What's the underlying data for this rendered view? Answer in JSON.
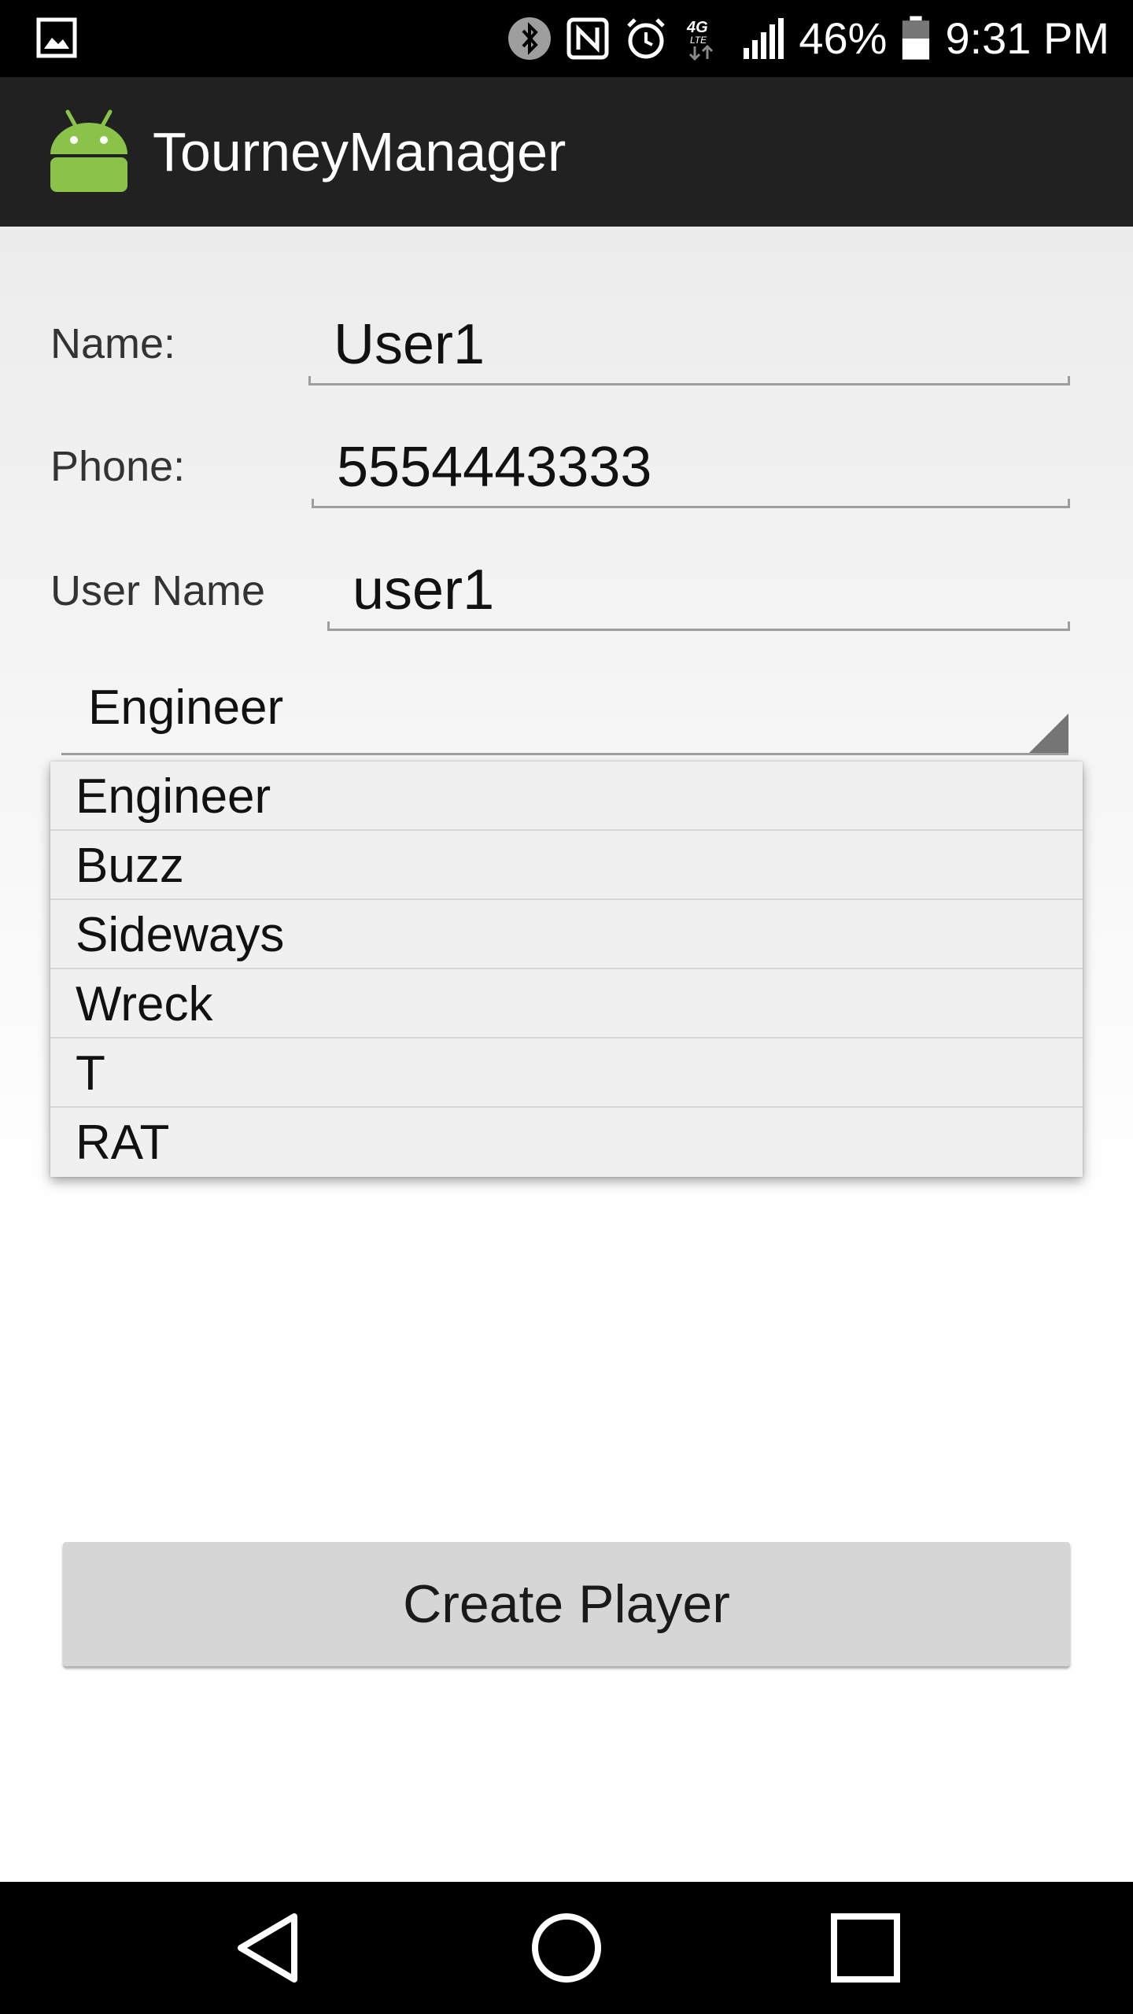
{
  "status_bar": {
    "battery_percent": "46%",
    "time": "9:31 PM",
    "network": "4G LTE",
    "icons": [
      "gallery-icon",
      "bluetooth-icon",
      "nfc-icon",
      "alarm-icon",
      "network-4g-lte-icon",
      "signal-icon",
      "battery-icon"
    ]
  },
  "app_bar": {
    "title": "TourneyManager",
    "logo_icon": "android-logo-icon"
  },
  "form": {
    "name_label": "Name:",
    "name_value": "User1",
    "phone_label": "Phone:",
    "phone_value": "5554443333",
    "username_label": "User Name",
    "username_value": "user1"
  },
  "spinner": {
    "selected": "Engineer",
    "options": [
      "Engineer",
      "Buzz",
      "Sideways",
      "Wreck",
      "T",
      "RAT"
    ]
  },
  "create_button": {
    "label": "Create Player"
  },
  "nav_bar": {
    "icons": [
      "back-icon",
      "home-icon",
      "recent-apps-icon"
    ]
  },
  "colors": {
    "status_bar_bg": "#000000",
    "app_bar_bg": "#212121",
    "android_green": "#8bc34a",
    "button_bg": "#d6d6d6"
  }
}
